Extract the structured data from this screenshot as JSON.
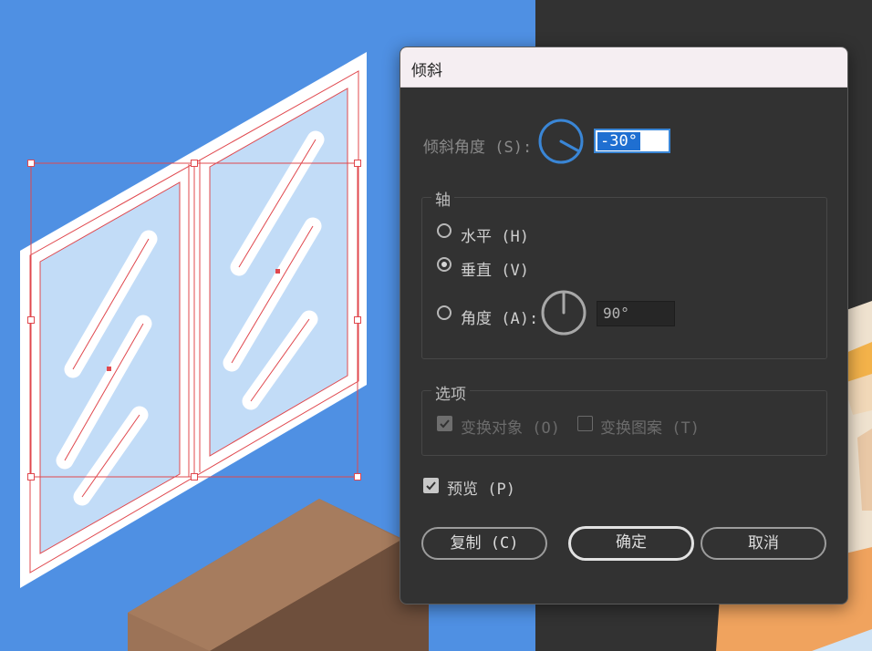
{
  "dialog": {
    "title": "倾斜",
    "shear_angle_label": "倾斜角度 (S):",
    "shear_angle_value": "-30°",
    "axis": {
      "legend": "轴",
      "horizontal_label": "水平 (H)",
      "vertical_label": "垂直 (V)",
      "angle_label": "角度 (A):",
      "angle_value": "90°",
      "selected": "vertical"
    },
    "options": {
      "legend": "选项",
      "transform_objects_label": "变换对象 (O)",
      "transform_objects_checked": true,
      "transform_patterns_label": "变换图案 (T)",
      "transform_patterns_checked": false
    },
    "preview_label": "预览 (P)",
    "preview_checked": true,
    "buttons": {
      "copy": "复制 (C)",
      "ok": "确定",
      "cancel": "取消"
    }
  },
  "colors": {
    "canvas_blue": "#4f90e3",
    "window_glass": "#c2dcf7",
    "window_frame": "#ffffff",
    "selection": "#e0484e",
    "accent": "#3a86d6",
    "dialog_bg": "#323232"
  }
}
